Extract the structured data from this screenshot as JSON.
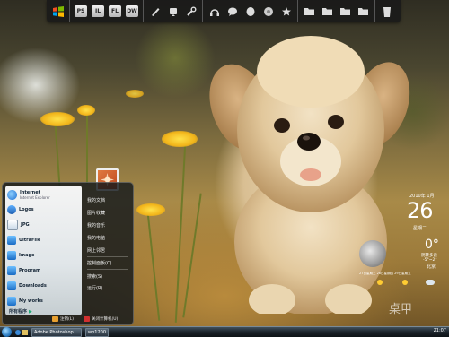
{
  "toolbar": {
    "apps": [
      "PS",
      "IL",
      "FL",
      "DW"
    ],
    "icons": [
      "windows-logo-icon",
      "brush-icon",
      "pencil-icon",
      "wrench-icon",
      "headphones-icon",
      "chat-icon",
      "leaf-icon",
      "chrome-icon",
      "star-icon",
      "folder-icon",
      "folder-icon",
      "folder-icon",
      "folder-icon",
      "trash-icon"
    ]
  },
  "start_menu": {
    "pinned": [
      {
        "label": "Internet",
        "sub": "Internet Explorer",
        "color": "#1f6fd1"
      },
      {
        "label": "Logos",
        "sub": "",
        "color": "#2a8ad8"
      },
      {
        "label": "JPG",
        "sub": "",
        "color": "#2a8ad8"
      },
      {
        "label": "UltraFile",
        "sub": "",
        "color": "#2a8ad8"
      },
      {
        "label": "Image",
        "sub": "",
        "color": "#2a8ad8"
      },
      {
        "label": "Program",
        "sub": "",
        "color": "#2a8ad8"
      },
      {
        "label": "Downloads",
        "sub": "",
        "color": "#2a8ad8"
      },
      {
        "label": "My works",
        "sub": "",
        "color": "#2a8ad8"
      }
    ],
    "all_programs": "所有程序",
    "right_items": [
      "我的文档",
      "图片收藏",
      "我的音乐",
      "我的电脑",
      "网上邻居",
      "控制面板(C)",
      "搜索(S)",
      "运行(R)..."
    ],
    "logoff": "注销(L)",
    "shutdown": "关闭计算机(U)"
  },
  "taskbar": {
    "tasks": [
      "Adobe Photoshop ...",
      "wp1200"
    ],
    "clock": "21:07"
  },
  "gadget": {
    "date": "2010年 1月",
    "day": "26",
    "weekday": "星期二",
    "temperature": "0°",
    "condition": "阴转多云",
    "range": "-5°~2°",
    "city": "北京",
    "forecast": "27日星期三  28日星期四  29日星期五"
  },
  "watermark": "桌甲"
}
